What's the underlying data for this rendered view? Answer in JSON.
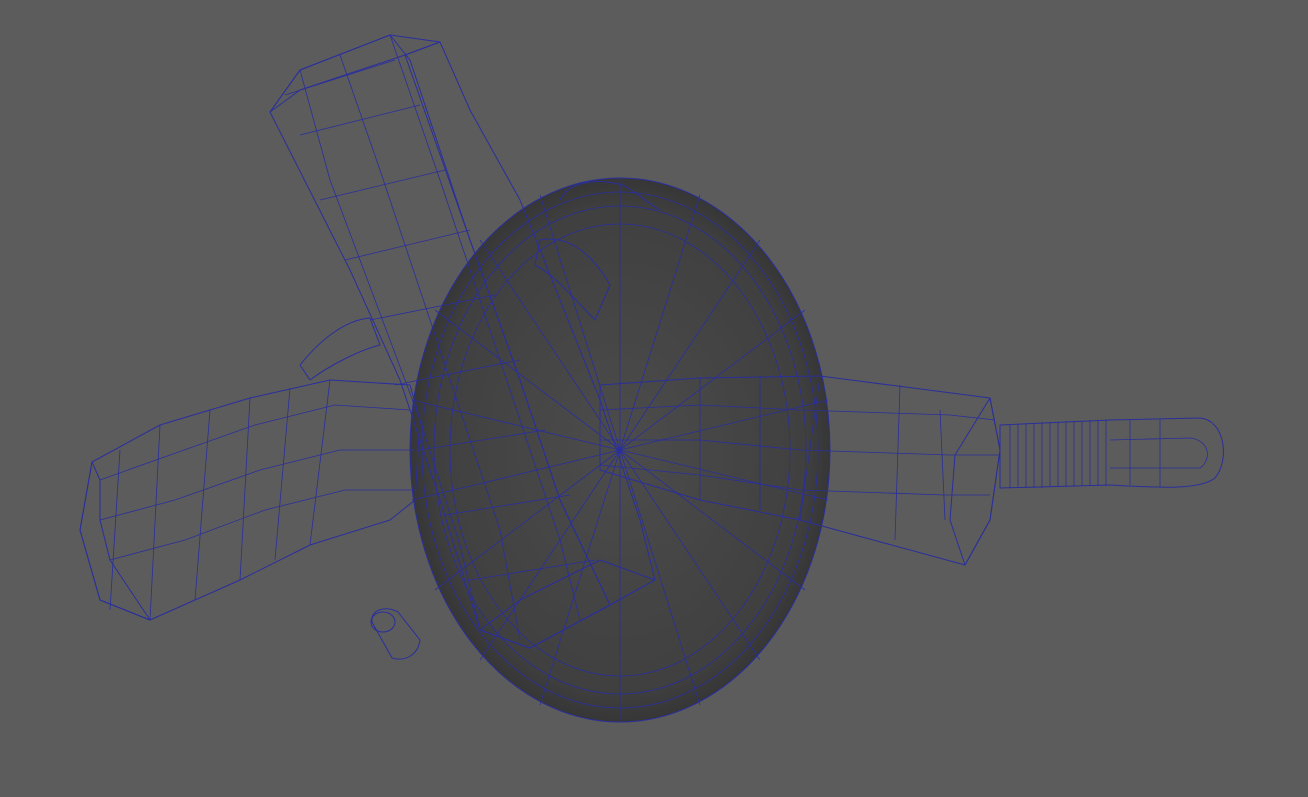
{
  "viewport": {
    "background_color": "#5c5c5c",
    "display_mode": "wireframe-on-shaded",
    "wireframe_color": "#2a2f9c",
    "mesh_colors": {
      "dark": "#2e2e2e",
      "mid": "#5a5a5a",
      "light": "#8c8c8c"
    }
  },
  "model": {
    "description_icon": "hand-drill-mesh-icon"
  }
}
